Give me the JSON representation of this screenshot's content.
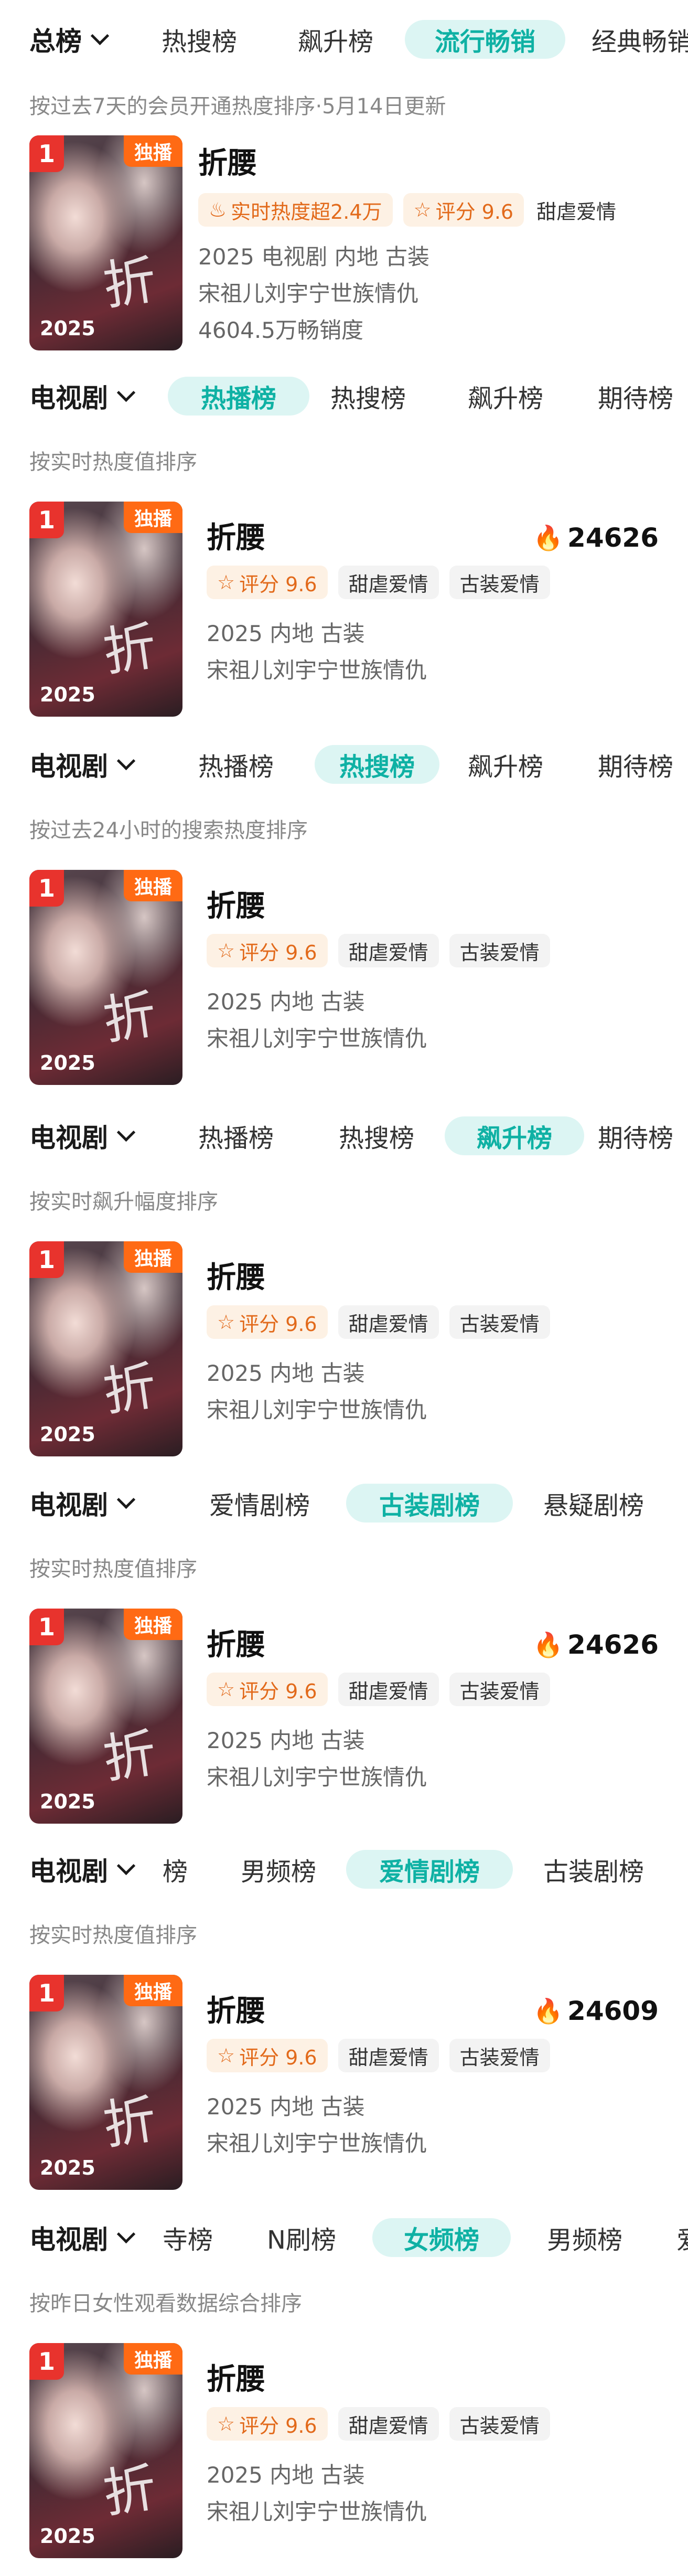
{
  "top": {
    "first_label": "总榜",
    "tabs": [
      "热搜榜",
      "飙升榜",
      "流行畅销",
      "经典畅销"
    ],
    "active_index": 2,
    "subtitle": "按过去7天的会员开通热度排序·5月14日更新",
    "card": {
      "rank": "1",
      "badge": "独播",
      "year": "2025",
      "calligraphy": "折",
      "title": "折腰",
      "tags": [
        {
          "icon": "flame-outline-icon",
          "glyph": "♨",
          "text": "实时热度超2.4万",
          "style": "orange"
        },
        {
          "icon": "star-outline-icon",
          "glyph": "☆",
          "text": "评分 9.6",
          "style": "orange"
        },
        {
          "icon": "",
          "glyph": "",
          "text": "甜虐爱情",
          "style": "gray"
        }
      ],
      "meta": [
        "2025 电视剧 内地 古装",
        "宋祖儿刘宇宁世族情仇",
        "4604.5万畅销度"
      ]
    }
  },
  "sections": [
    {
      "first_label": "电视剧",
      "tabs": [
        "热播榜",
        "热搜榜",
        "飙升榜",
        "期待榜"
      ],
      "active_index": 0,
      "subtitle": "按实时热度值排序",
      "card": {
        "rank": "1",
        "badge": "独播",
        "year": "2025",
        "calligraphy": "折",
        "title": "折腰",
        "heat": "24626",
        "tags": [
          "评分 9.6",
          "甜虐爱情",
          "古装爱情"
        ],
        "meta": [
          "2025 内地 古装",
          "宋祖儿刘宇宁世族情仇"
        ]
      }
    },
    {
      "first_label": "电视剧",
      "tabs": [
        "热播榜",
        "热搜榜",
        "飙升榜",
        "期待榜"
      ],
      "active_index": 1,
      "subtitle": "按过去24小时的搜索热度排序",
      "card": {
        "rank": "1",
        "badge": "独播",
        "year": "2025",
        "calligraphy": "折",
        "title": "折腰",
        "heat": "",
        "tags": [
          "评分 9.6",
          "甜虐爱情",
          "古装爱情"
        ],
        "meta": [
          "2025 内地 古装",
          "宋祖儿刘宇宁世族情仇"
        ]
      }
    },
    {
      "first_label": "电视剧",
      "tabs": [
        "热播榜",
        "热搜榜",
        "飙升榜",
        "期待榜"
      ],
      "active_index": 2,
      "subtitle": "按实时飙升幅度排序",
      "card": {
        "rank": "1",
        "badge": "独播",
        "year": "2025",
        "calligraphy": "折",
        "title": "折腰",
        "heat": "",
        "tags": [
          "评分 9.6",
          "甜虐爱情",
          "古装爱情"
        ],
        "meta": [
          "2025 内地 古装",
          "宋祖儿刘宇宁世族情仇"
        ]
      }
    },
    {
      "first_label": "电视剧",
      "tabs": [
        "爱情剧榜",
        "古装剧榜",
        "悬疑剧榜"
      ],
      "active_index": 1,
      "subtitle": "按实时热度值排序",
      "card": {
        "rank": "1",
        "badge": "独播",
        "year": "2025",
        "calligraphy": "折",
        "title": "折腰",
        "heat": "24626",
        "tags": [
          "评分 9.6",
          "甜虐爱情",
          "古装爱情"
        ],
        "meta": [
          "2025 内地 古装",
          "宋祖儿刘宇宁世族情仇"
        ]
      }
    },
    {
      "first_label": "电视剧",
      "tabs": [
        "榜",
        "男频榜",
        "爱情剧榜",
        "古装剧榜"
      ],
      "active_index": 2,
      "subtitle": "按实时热度值排序",
      "card": {
        "rank": "1",
        "badge": "独播",
        "year": "2025",
        "calligraphy": "折",
        "title": "折腰",
        "heat": "24609",
        "tags": [
          "评分 9.6",
          "甜虐爱情",
          "古装爱情"
        ],
        "meta": [
          "2025 内地 古装",
          "宋祖儿刘宇宁世族情仇"
        ]
      }
    },
    {
      "first_label": "电视剧",
      "tabs": [
        "寺榜",
        "N刷榜",
        "女频榜",
        "男频榜",
        "爱"
      ],
      "active_index": 2,
      "subtitle": "按昨日女性观看数据综合排序",
      "card": {
        "rank": "1",
        "badge": "独播",
        "year": "2025",
        "calligraphy": "折",
        "title": "折腰",
        "heat": "",
        "tags": [
          "评分 9.6",
          "甜虐爱情",
          "古装爱情"
        ],
        "meta": [
          "2025 内地 古装",
          "宋祖儿刘宇宁世族情仇"
        ]
      }
    }
  ]
}
